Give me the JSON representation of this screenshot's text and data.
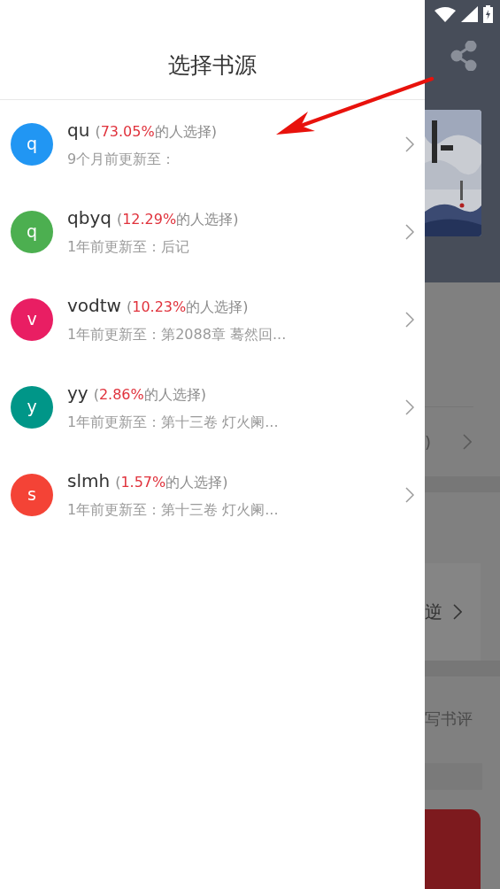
{
  "drawer": {
    "title": "选择书源",
    "sources": [
      {
        "avatar_letter": "q",
        "color": "#2196f3",
        "name": "qu",
        "share_open": "(",
        "share": "73.05%",
        "share_close": "的人选择)",
        "update": "9个月前更新至："
      },
      {
        "avatar_letter": "q",
        "color": "#4caf50",
        "name": "qbyq",
        "share_open": "(",
        "share": "12.29%",
        "share_close": "的人选择)",
        "update": "1年前更新至：后记"
      },
      {
        "avatar_letter": "v",
        "color": "#e91e63",
        "name": "vodtw",
        "share_open": "(",
        "share": "10.23%",
        "share_close": "的人选择)",
        "update": "1年前更新至：第2088章 蓦然回..."
      },
      {
        "avatar_letter": "y",
        "color": "#009688",
        "name": "yy",
        "share_open": "(",
        "share": "2.86%",
        "share_close": "的人选择)",
        "update": "1年前更新至：第十三卷 灯火阑..."
      },
      {
        "avatar_letter": "s",
        "color": "#f44336",
        "name": "slmh",
        "share_open": "(",
        "share": "1.57%",
        "share_close": "的人选择)",
        "update": "1年前更新至：第十三卷 灯火阑..."
      }
    ]
  },
  "background_page": {
    "row_fragment": ")",
    "book_title_fragment": "逆",
    "review_link": "写书评"
  }
}
